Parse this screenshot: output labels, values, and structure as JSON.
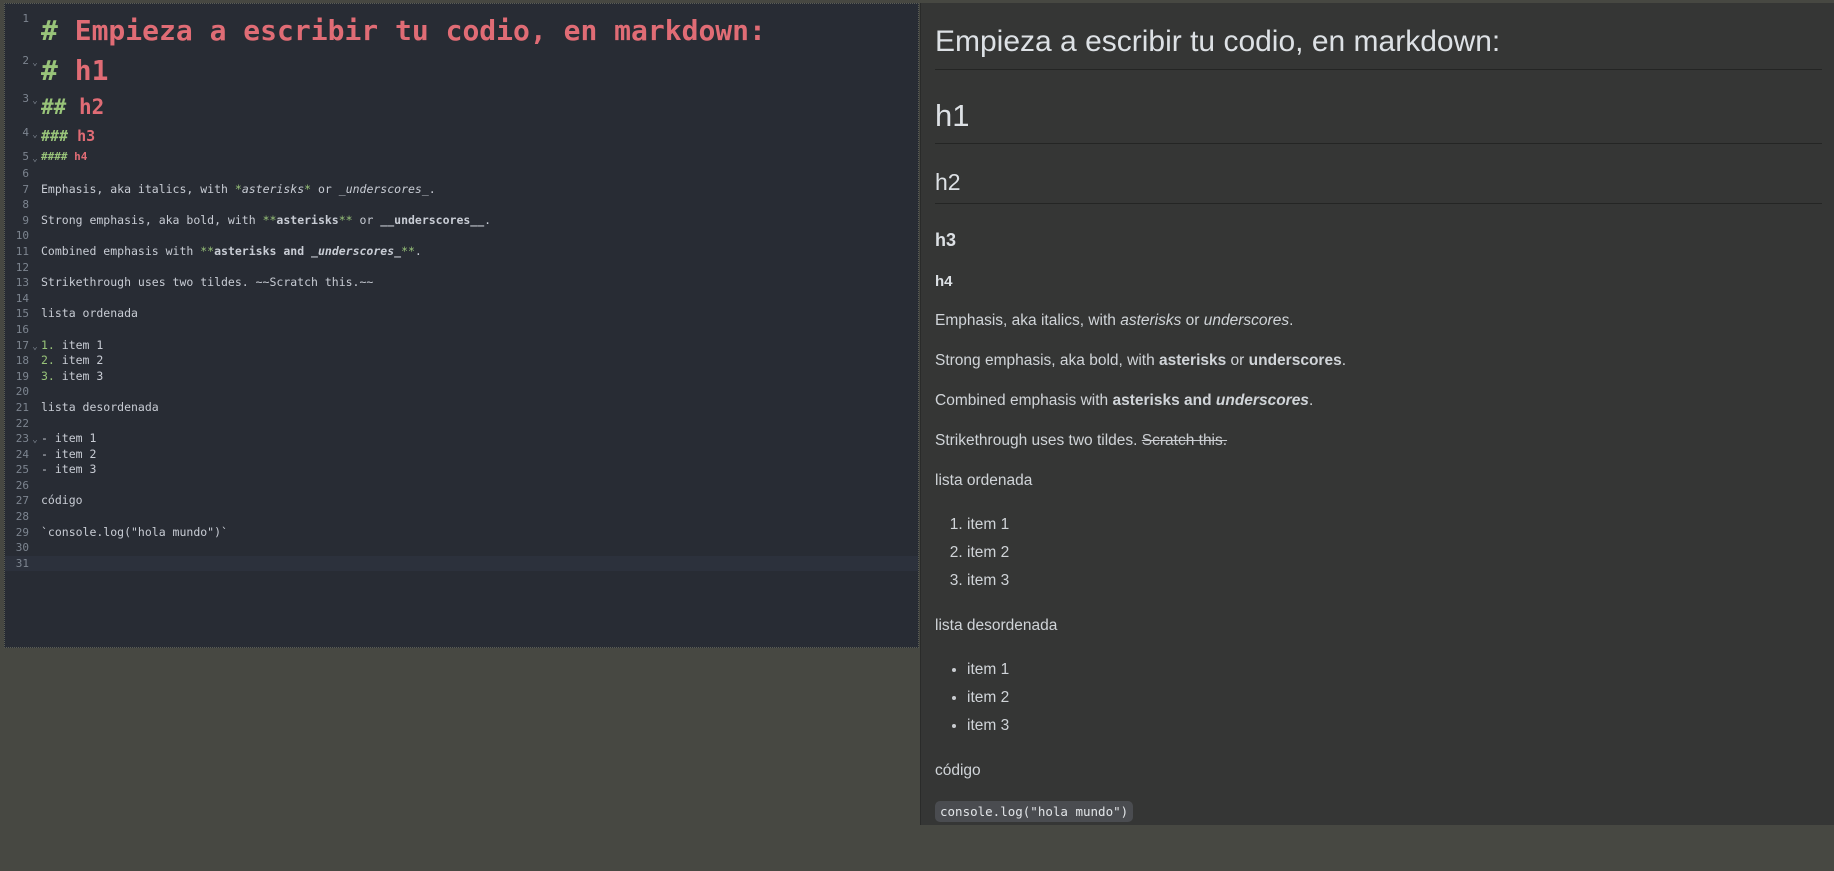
{
  "editor": {
    "lines": [
      {
        "n": "1",
        "fold": "",
        "parts": [
          [
            "mk",
            "# "
          ],
          [
            "hd",
            "Empieza a escribir tu codio, en markdown:"
          ]
        ],
        "cls": "l-h1big"
      },
      {
        "n": "2",
        "fold": "v",
        "parts": [
          [
            "mk",
            "# "
          ],
          [
            "hd",
            "h1"
          ]
        ],
        "cls": "l-h1"
      },
      {
        "n": "3",
        "fold": "v",
        "parts": [
          [
            "mk",
            "## "
          ],
          [
            "hd",
            "h2"
          ]
        ],
        "cls": "l-h2"
      },
      {
        "n": "4",
        "fold": "v",
        "parts": [
          [
            "mk",
            "### "
          ],
          [
            "hd",
            "h3"
          ]
        ],
        "cls": "l-h3"
      },
      {
        "n": "5",
        "fold": "v",
        "parts": [
          [
            "mk",
            "#### "
          ],
          [
            "hd",
            "h4"
          ]
        ],
        "cls": "l-h4"
      },
      {
        "n": "6",
        "fold": "",
        "parts": [],
        "cls": ""
      },
      {
        "n": "7",
        "fold": "",
        "parts": [
          [
            "",
            "Emphasis, aka italics, with "
          ],
          [
            "mk",
            "*"
          ],
          [
            "it",
            "asterisks"
          ],
          [
            "mk",
            "*"
          ],
          [
            "",
            " or "
          ],
          [
            "it",
            "_underscores_"
          ],
          [
            "",
            "."
          ]
        ],
        "cls": ""
      },
      {
        "n": "8",
        "fold": "",
        "parts": [],
        "cls": ""
      },
      {
        "n": "9",
        "fold": "",
        "parts": [
          [
            "",
            "Strong emphasis, aka bold, with "
          ],
          [
            "mk",
            "**"
          ],
          [
            "bd",
            "asterisks"
          ],
          [
            "mk",
            "**"
          ],
          [
            "",
            " or "
          ],
          [
            "bd",
            "__underscores__"
          ],
          [
            "",
            "."
          ]
        ],
        "cls": ""
      },
      {
        "n": "10",
        "fold": "",
        "parts": [],
        "cls": ""
      },
      {
        "n": "11",
        "fold": "",
        "parts": [
          [
            "",
            "Combined emphasis with "
          ],
          [
            "mk",
            "**"
          ],
          [
            "bd",
            "asterisks and "
          ],
          [
            "bd it",
            "_underscores_"
          ],
          [
            "mk",
            "**"
          ],
          [
            "",
            "."
          ]
        ],
        "cls": ""
      },
      {
        "n": "12",
        "fold": "",
        "parts": [],
        "cls": ""
      },
      {
        "n": "13",
        "fold": "",
        "parts": [
          [
            "",
            "Strikethrough uses two tildes. ~~Scratch this.~~"
          ]
        ],
        "cls": ""
      },
      {
        "n": "14",
        "fold": "",
        "parts": [],
        "cls": ""
      },
      {
        "n": "15",
        "fold": "",
        "parts": [
          [
            "",
            "lista ordenada"
          ]
        ],
        "cls": ""
      },
      {
        "n": "16",
        "fold": "",
        "parts": [],
        "cls": ""
      },
      {
        "n": "17",
        "fold": "v",
        "parts": [
          [
            "mk",
            "1."
          ],
          [
            "",
            " item 1"
          ]
        ],
        "cls": ""
      },
      {
        "n": "18",
        "fold": "",
        "parts": [
          [
            "mk",
            "2."
          ],
          [
            "",
            " item 2"
          ]
        ],
        "cls": ""
      },
      {
        "n": "19",
        "fold": "",
        "parts": [
          [
            "mk",
            "3."
          ],
          [
            "",
            " item 3"
          ]
        ],
        "cls": ""
      },
      {
        "n": "20",
        "fold": "",
        "parts": [],
        "cls": ""
      },
      {
        "n": "21",
        "fold": "",
        "parts": [
          [
            "",
            "lista desordenada"
          ]
        ],
        "cls": ""
      },
      {
        "n": "22",
        "fold": "",
        "parts": [],
        "cls": ""
      },
      {
        "n": "23",
        "fold": "v",
        "parts": [
          [
            "",
            "- item 1"
          ]
        ],
        "cls": ""
      },
      {
        "n": "24",
        "fold": "",
        "parts": [
          [
            "",
            "- item 2"
          ]
        ],
        "cls": ""
      },
      {
        "n": "25",
        "fold": "",
        "parts": [
          [
            "",
            "- item 3"
          ]
        ],
        "cls": ""
      },
      {
        "n": "26",
        "fold": "",
        "parts": [],
        "cls": ""
      },
      {
        "n": "27",
        "fold": "",
        "parts": [
          [
            "",
            "código"
          ]
        ],
        "cls": ""
      },
      {
        "n": "28",
        "fold": "",
        "parts": [],
        "cls": ""
      },
      {
        "n": "29",
        "fold": "",
        "parts": [
          [
            "",
            "`console.log(\"hola mundo\")`"
          ]
        ],
        "cls": ""
      },
      {
        "n": "30",
        "fold": "",
        "parts": [],
        "cls": ""
      },
      {
        "n": "31",
        "fold": "",
        "parts": [],
        "cls": "active-line"
      }
    ]
  },
  "preview": {
    "h1a": "Empieza a escribir tu codio, en markdown:",
    "h1b": "h1",
    "h2": "h2",
    "h3": "h3",
    "h4": "h4",
    "emphasis": {
      "pre": "Emphasis, aka italics, with ",
      "em1": "asterisks",
      "mid": " or ",
      "em2": "underscores",
      "post": "."
    },
    "strong": {
      "pre": "Strong emphasis, aka bold, with ",
      "b1": "asterisks",
      "mid": " or ",
      "b2": "underscores",
      "post": "."
    },
    "combined": {
      "pre": "Combined emphasis with ",
      "b": "asterisks and ",
      "bi": "underscores",
      "post": "."
    },
    "strike": {
      "pre": "Strikethrough uses two tildes. ",
      "del": "Scratch this."
    },
    "ordered_label": "lista ordenada",
    "ordered_items": [
      "item 1",
      "item 2",
      "item 3"
    ],
    "unordered_label": "lista desordenada",
    "unordered_items": [
      "item 1",
      "item 2",
      "item 3"
    ],
    "code_label": "código",
    "code": "console.log(\"hola mundo\")"
  },
  "colors": {
    "editor_bg": "#282c34",
    "markup": "#98c379",
    "heading": "#e06c75",
    "preview_bg": "#353635",
    "page_bg": "#474842"
  }
}
